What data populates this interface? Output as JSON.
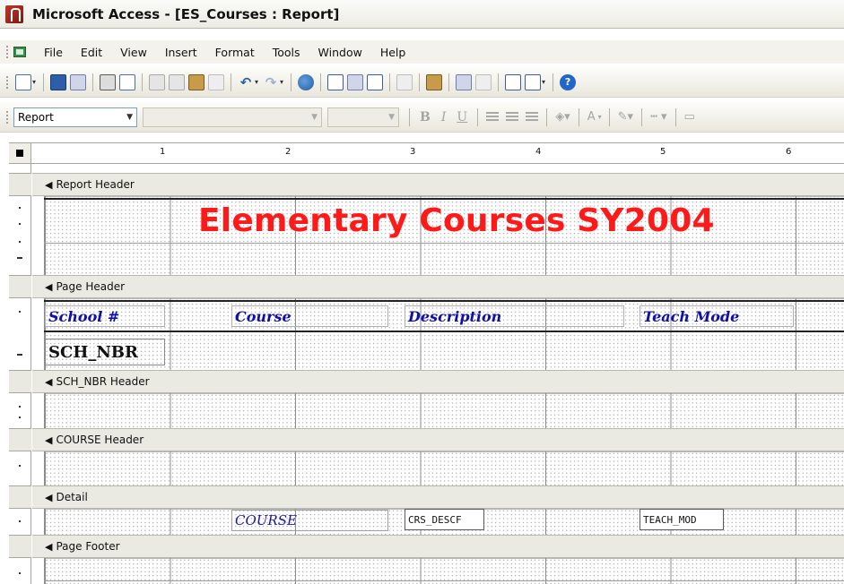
{
  "window": {
    "title": "Microsoft Access - [ES_Courses : Report]"
  },
  "menu": {
    "items": [
      "File",
      "Edit",
      "View",
      "Insert",
      "Format",
      "Tools",
      "Window",
      "Help"
    ]
  },
  "toolbar_formatting": {
    "object_combo_value": "Report",
    "font_name_value": "",
    "font_size_value": "",
    "bold_label": "B",
    "italic_label": "I",
    "underline_label": "U",
    "font_color_label": "A"
  },
  "ruler": {
    "numbers": [
      "1",
      "2",
      "3",
      "4",
      "5",
      "6"
    ]
  },
  "report": {
    "sections": {
      "report_header": "Report Header",
      "page_header": "Page Header",
      "sch_nbr_header": "SCH_NBR Header",
      "course_header": "COURSE Header",
      "detail": "Detail",
      "page_footer": "Page Footer"
    },
    "title_label": "Elementary Courses SY2004",
    "page_header_labels": {
      "school": "School #",
      "course": "Course",
      "description": "Description",
      "teach_mode": "Teach Mode"
    },
    "sch_nbr_field": "SCH_NBR",
    "detail_fields": {
      "course": "COURSE",
      "crs_desc": "CRS_DESCF",
      "teach_mode": "TEACH_MOD"
    }
  },
  "colors": {
    "title_red": "#ff1a1a",
    "label_blue": "#1010a8"
  }
}
